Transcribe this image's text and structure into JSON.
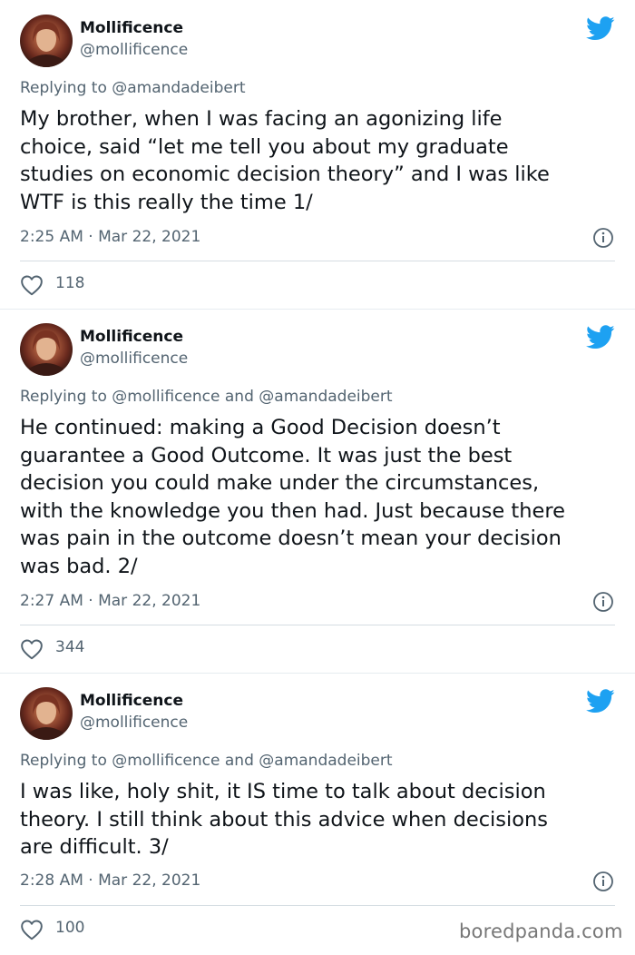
{
  "tweets": [
    {
      "author": {
        "name": "Mollificence",
        "handle": "@mollificence"
      },
      "replying": {
        "prefix": "Replying to",
        "mentions": [
          "@amandadeibert"
        ],
        "joiner": ""
      },
      "lines": [
        "My brother, when I was facing an agonizing life",
        "choice, said “let me tell you about my graduate",
        "studies on economic decision theory” and I was like",
        "WTF is this really the time 1/"
      ],
      "time": "2:25 AM · Mar 22, 2021",
      "likes": "118"
    },
    {
      "author": {
        "name": "Mollificence",
        "handle": "@mollificence"
      },
      "replying": {
        "prefix": "Replying to",
        "mentions": [
          "@mollificence",
          "@amandadeibert"
        ],
        "joiner": "and"
      },
      "lines": [
        "He continued: making a Good Decision doesn’t",
        "guarantee a Good Outcome. It was just the best",
        "decision you could make under the circumstances,",
        "with the knowledge you then had. Just because there",
        "was pain in the outcome doesn’t mean your decision",
        "was bad. 2/"
      ],
      "time": "2:27 AM · Mar 22, 2021",
      "likes": "344"
    },
    {
      "author": {
        "name": "Mollificence",
        "handle": "@mollificence"
      },
      "replying": {
        "prefix": "Replying to",
        "mentions": [
          "@mollificence",
          "@amandadeibert"
        ],
        "joiner": "and"
      },
      "lines": [
        "I was like, holy shit, it IS time to talk about decision",
        "theory. I still think about this advice when decisions",
        "are difficult. 3/"
      ],
      "time": "2:28 AM · Mar 22, 2021",
      "likes": "100"
    }
  ],
  "watermark": "boredpanda.com",
  "colors": {
    "twitter_blue": "#1da1f2",
    "secondary_text": "#536471",
    "primary_text": "#0f1419"
  },
  "icons": {
    "bird": "twitter-bird-icon",
    "info": "info-icon",
    "like": "heart-icon"
  }
}
